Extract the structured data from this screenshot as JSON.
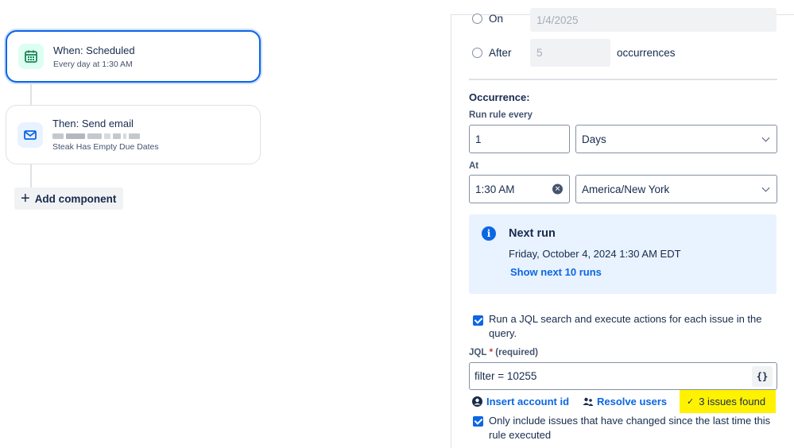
{
  "workflow": {
    "trigger": {
      "title": "When: Scheduled",
      "subtitle": "Every day at 1:30 AM",
      "icon": "calendar-icon"
    },
    "action": {
      "title": "Then: Send email",
      "subtitle": "Steak Has Empty Due Dates",
      "icon": "mail-icon"
    },
    "add_component_label": "Add component"
  },
  "schedule": {
    "end_options": [
      {
        "label": "On",
        "value": "1/4/2025"
      },
      {
        "label": "After",
        "value": "5",
        "suffix": "occurrences"
      }
    ],
    "occurrence_heading": "Occurrence:",
    "run_rule_label": "Run rule every",
    "interval_value": "1",
    "interval_unit": "Days",
    "at_label": "At",
    "time_value": "1:30 AM",
    "timezone": "America/New York"
  },
  "next_run": {
    "title": "Next run",
    "datetime": "Friday, October 4, 2024 1:30 AM EDT",
    "show_next_label": "Show next 10 runs"
  },
  "jql": {
    "checkbox_label": "Run a JQL search and execute actions for each issue in the query.",
    "label": "JQL",
    "required_star": "*",
    "required_text": "(required)",
    "value": "filter = 10255",
    "curly_label": "{}",
    "insert_account_label": "Insert account id",
    "resolve_users_label": "Resolve users",
    "issues_found_label": "3 issues found",
    "only_changed_label": "Only include issues that have changed since the last time this rule executed"
  },
  "colors": {
    "accent": "#0c66e4",
    "highlight": "#fff200",
    "info_bg": "#e9f2ff"
  }
}
